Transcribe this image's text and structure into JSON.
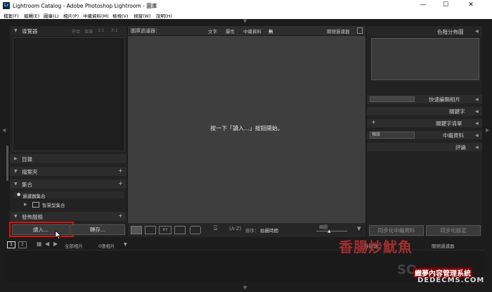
{
  "window": {
    "title": "Lightroom Catalog - Adobe Photoshop Lightroom - 圖庫",
    "app_icon": "Lr",
    "minimize": "—",
    "maximize": "☐",
    "close": "✕"
  },
  "menu": [
    "檔案(F)",
    "編輯(E)",
    "圖庫(L)",
    "相片(P)",
    "中繼資料(M)",
    "檢視(V)",
    "視窗(W)",
    "說明(H)"
  ],
  "left_panel": {
    "navigator": {
      "title": "導覽器",
      "options": [
        "符合",
        "填滿",
        "1:1",
        "3:1"
      ]
    },
    "catalog": "目錄",
    "folders": "檔案夾",
    "collections": "集合",
    "collection_items": [
      "過濾器集合",
      "智慧型集合"
    ],
    "publish": "發佈服務",
    "import_button": "讀入...",
    "export_button": "轉存..."
  },
  "filter_bar": {
    "label": "圖庫過濾器：",
    "tabs": [
      "文字",
      "屬性",
      "中繼資料",
      "無"
    ],
    "filter_off": "關閉過濾器"
  },
  "center": {
    "message": "按一下「讀入...」按鈕開始。"
  },
  "toolbar": {
    "sort_label": "排序：",
    "sort_value": "拍攝時間",
    "thumbnails_label": "縮圖"
  },
  "right_panel": {
    "histogram": "色階分佈圖",
    "quick_develop": "快速編輯相片",
    "keywording": "關鍵字",
    "keyword_list": "關鍵字清單",
    "preset": "預設",
    "metadata": "中繼資料",
    "comments": "評論",
    "sync_metadata": "同步化中繼資料",
    "sync_settings": "同步化設定"
  },
  "filmstrip": {
    "screen1": "1",
    "screen2": "2",
    "source": "全部相片",
    "count": "0張相片",
    "filter_label": "過濾器：",
    "filter_value": "關閉過濾器"
  },
  "watermark": {
    "brand": "香腸炒魷魚",
    "site": "織夢內容管理系統",
    "url": "DEDECMS.COM",
    "so": "SO"
  }
}
